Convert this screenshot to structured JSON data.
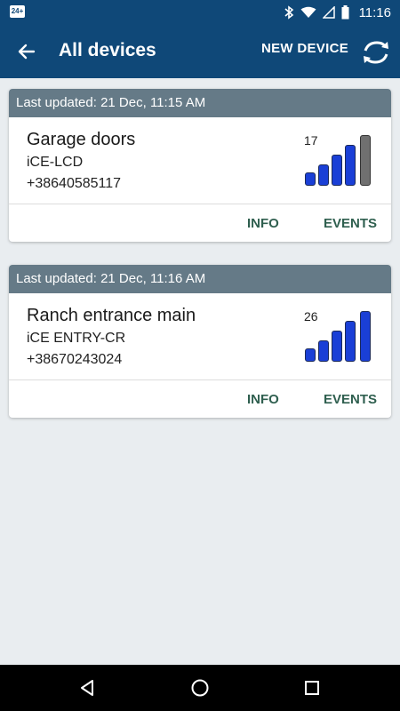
{
  "status_bar": {
    "app_badge": "24+",
    "time": "11:16"
  },
  "app_bar": {
    "title": "All devices",
    "new_device_label": "NEW DEVICE"
  },
  "devices": [
    {
      "last_updated": "Last updated: 21 Dec, 11:15 AM",
      "name": "Garage doors",
      "model": "iCE-LCD",
      "phone": "+38640585117",
      "signal": 17,
      "signal_bars": [
        1,
        1,
        1,
        1,
        0
      ],
      "info_label": "INFO",
      "events_label": "EVENTS"
    },
    {
      "last_updated": "Last updated: 21 Dec, 11:16 AM",
      "name": "Ranch entrance main",
      "model": "iCE ENTRY-CR",
      "phone": "+38670243024",
      "signal": 26,
      "signal_bars": [
        1,
        1,
        1,
        1,
        1
      ],
      "info_label": "INFO",
      "events_label": "EVENTS"
    }
  ],
  "colors": {
    "primary": "#0f4878",
    "card_header": "#657a87",
    "bar_active": "#1a3fd6",
    "bar_inactive": "#707070",
    "action_text": "#2f5f4f"
  }
}
